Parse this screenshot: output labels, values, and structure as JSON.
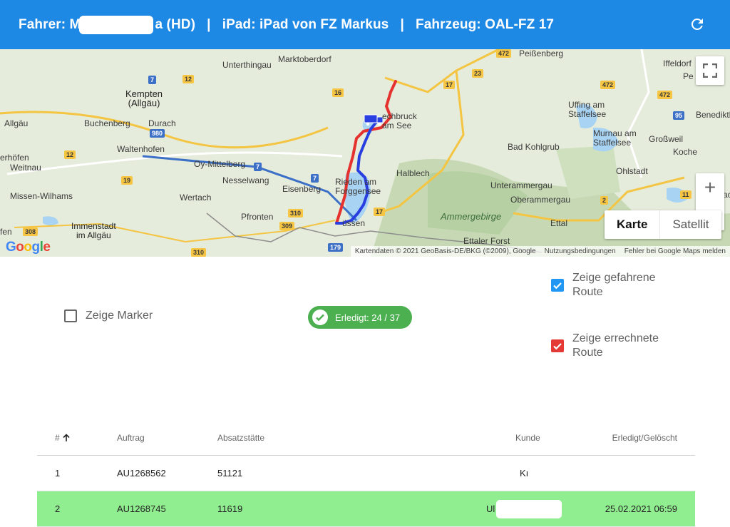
{
  "header": {
    "driver_prefix": "Fahrer: M",
    "driver_suffix": "a (HD)",
    "separator": "|",
    "ipad": "iPad: iPad von FZ Markus",
    "vehicle": "Fahrzeug: OAL-FZ 17",
    "refresh_icon": "refresh-icon"
  },
  "map": {
    "labels": {
      "unterthingau": "Unterthingau",
      "marktoberdorf": "Marktoberdorf",
      "peissenberg": "Peißenberg",
      "iffeldorf": "Iffeldorf",
      "kempten": "Kempten\n(Allgäu)",
      "allgaeu": "Allgäu",
      "buchenberg": "Buchenberg",
      "durach": "Durach",
      "waltenhofen": "Waltenhofen",
      "erhoefen": "erhöfen",
      "weitnau": "Weitnau",
      "missen": "Missen-Wilhams",
      "oy": "Oy-Mittelberg",
      "nesselwang": "Nesselwang",
      "wertach": "Wertach",
      "eisenberg": "Eisenberg",
      "pfronten": "Pfronten",
      "immenstadt": "Immenstadt\nim Allgäu",
      "fen": "fen",
      "lechbruck": "echbruck\nam See",
      "rieden": "Rieden am\nForggensee",
      "fuessen": "üssen",
      "halblech": "Halblech",
      "bad_kohlgrub": "Bad Kohlgrub",
      "uffing": "Uffing am\nStaffelsee",
      "murnau": "Murnau am\nStaffelsee",
      "grossweil": "Großweil",
      "benediktb": "Benediktb",
      "koche": "Koche",
      "ohlstadt": "Ohlstadt",
      "unterammergau": "Unterammergau",
      "oberammergau": "Oberammergau",
      "ettal": "Ettal",
      "ettaler_forst": "Ettaler Forst",
      "ammergebirge": "Ammergebirge",
      "jac": "Jac",
      "pe": "Pe"
    },
    "shields": {
      "s7a": "7",
      "s12a": "12",
      "s16": "16",
      "s472a": "472",
      "s23": "23",
      "s17a": "17",
      "s472b": "472",
      "s472c": "472",
      "s95": "95",
      "s980": "980",
      "s12b": "12",
      "s19": "19",
      "s7b": "7",
      "s7c": "7",
      "s310a": "310",
      "s309": "309",
      "s17b": "17",
      "s179": "179",
      "s308": "308",
      "s310b": "310",
      "s2": "2",
      "s11": "11"
    },
    "map_type_active": "Karte",
    "map_type_inactive": "Satellit",
    "google_logo": "Google",
    "attribution": "Kartendaten © 2021 GeoBasis-DE/BKG (©2009), Google",
    "terms": "Nutzungsbedingungen",
    "report": "Fehler bei Google Maps melden",
    "fullscreen_icon": "fullscreen-icon",
    "zoom_in": "+",
    "zoom_out": "−",
    "route_driven_color": "#2a3fe0",
    "route_calculated_color": "#e5322f"
  },
  "options": {
    "show_marker": {
      "label": "Zeige Marker",
      "checked": false
    },
    "show_driven": {
      "label": "Zeige gefahrene\nRoute",
      "checked": true,
      "color": "#2196f3"
    },
    "show_calculated": {
      "label": "Zeige errechnete\nRoute",
      "checked": true,
      "color": "#e53935"
    }
  },
  "status_chip": {
    "text": "Erledigt: 24 / 37",
    "color": "#4caf50",
    "icon": "check-circle-icon"
  },
  "table": {
    "columns": {
      "num": "#",
      "sort_icon": "arrow-up-icon",
      "order": "Auftrag",
      "outlet": "Absatzstätte",
      "customer": "Kunde",
      "done": "Erledigt/Gelöscht"
    },
    "rows": [
      {
        "num": "1",
        "order": "AU1268562",
        "outlet": "51121",
        "customer": "Kı",
        "done": ""
      },
      {
        "num": "2",
        "order": "AU1268745",
        "outlet": "11619",
        "customer": "Ul",
        "done": "25.02.2021 06:59",
        "highlight_color": "#90ee90"
      }
    ]
  }
}
